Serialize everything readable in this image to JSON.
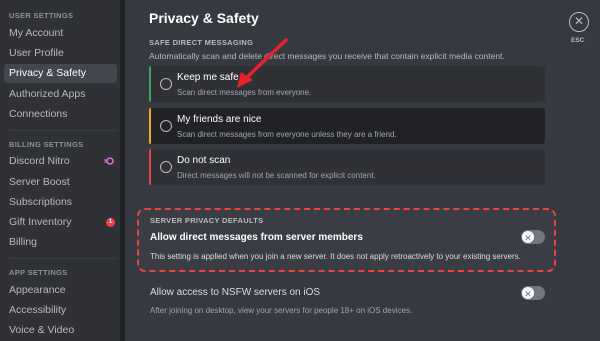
{
  "sidebar": {
    "user_settings_header": "USER SETTINGS",
    "user_items": [
      "My Account",
      "User Profile",
      "Privacy & Safety",
      "Authorized Apps",
      "Connections"
    ],
    "billing_header": "BILLING SETTINGS",
    "billing_items": [
      "Discord Nitro",
      "Server Boost",
      "Subscriptions",
      "Gift Inventory",
      "Billing"
    ],
    "gift_badge": "1",
    "app_header": "APP SETTINGS",
    "app_items": [
      "Appearance",
      "Accessibility",
      "Voice & Video"
    ]
  },
  "main": {
    "title": "Privacy & Safety",
    "sdm_header": "SAFE DIRECT MESSAGING",
    "sdm_desc": "Automatically scan and delete direct messages you receive that contain explicit media content.",
    "options": [
      {
        "title": "Keep me safe",
        "sub": "Scan direct messages from everyone.",
        "stripe": "#3ba55d"
      },
      {
        "title": "My friends are nice",
        "sub": "Scan direct messages from everyone unless they are a friend.",
        "stripe": "#faa81a"
      },
      {
        "title": "Do not scan",
        "sub": "Direct messages will not be scanned for explicit content.",
        "stripe": "#ed4245"
      }
    ],
    "spd_header": "SERVER PRIVACY DEFAULTS",
    "spd_title": "Allow direct messages from server members",
    "spd_desc": "This setting is applied when you join a new server. It does not apply retroactively to your existing servers.",
    "nsfw_title": "Allow access to NSFW servers on iOS",
    "nsfw_desc": "After joining on desktop, view your servers for people 18+ on iOS devices.",
    "toggle_symbol": "✕",
    "close_symbol": "✕",
    "esc_label": "ESC"
  },
  "colors": {
    "highlight": "#ed4245"
  }
}
